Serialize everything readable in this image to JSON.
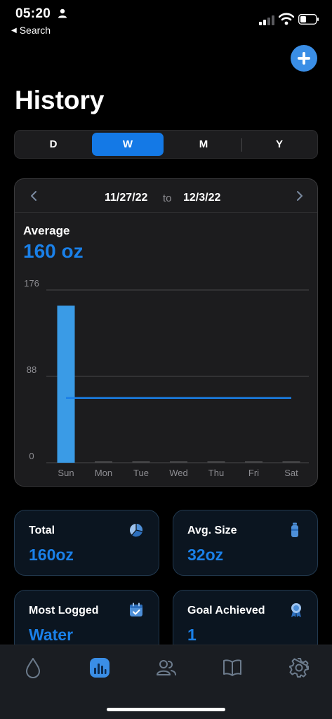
{
  "status_bar": {
    "time": "05:20",
    "back_label": "Search"
  },
  "header": {
    "title": "History"
  },
  "period_tabs": [
    {
      "label": "D",
      "active": false
    },
    {
      "label": "W",
      "active": true
    },
    {
      "label": "M",
      "active": false
    },
    {
      "label": "Y",
      "active": false
    }
  ],
  "range": {
    "start": "11/27/22",
    "separator": "to",
    "end": "12/3/22"
  },
  "average": {
    "label": "Average",
    "value": "160 oz"
  },
  "chart_data": {
    "type": "bar",
    "categories": [
      "Sun",
      "Mon",
      "Tue",
      "Wed",
      "Thu",
      "Fri",
      "Sat"
    ],
    "values": [
      160,
      0,
      0,
      0,
      0,
      0,
      0
    ],
    "y_ticks": [
      "176",
      "88",
      "0"
    ],
    "ylim": [
      0,
      176
    ],
    "average_line": 66,
    "grid": true,
    "colors": {
      "bar": "#3a9be6",
      "average_line": "#1a7fe8",
      "grid": "#48484a",
      "empty_bar": "#48484a"
    }
  },
  "stats": {
    "total": {
      "label": "Total",
      "value": "160oz",
      "icon": "pie-chart-icon"
    },
    "avg_size": {
      "label": "Avg. Size",
      "value": "32oz",
      "icon": "bottle-icon"
    },
    "most_logged": {
      "label": "Most Logged",
      "value": "Water",
      "icon": "calendar-check-icon"
    },
    "goal_achieved": {
      "label": "Goal Achieved",
      "value": "1",
      "icon": "award-icon"
    }
  },
  "tabs": [
    {
      "name": "drop-icon",
      "active": false
    },
    {
      "name": "history-chart-icon",
      "active": true
    },
    {
      "name": "people-icon",
      "active": false
    },
    {
      "name": "book-icon",
      "active": false
    },
    {
      "name": "settings-icon",
      "active": false
    }
  ],
  "colors": {
    "accent": "#1479e6",
    "background": "#000000",
    "card": "#1c1c1e"
  }
}
